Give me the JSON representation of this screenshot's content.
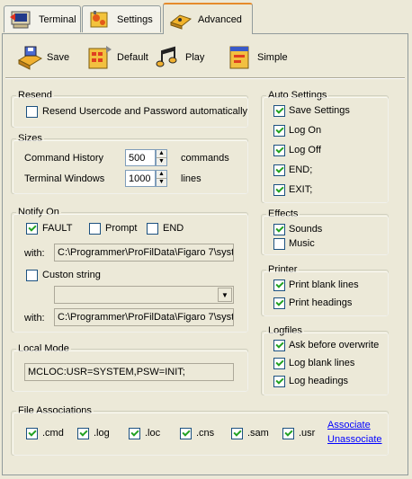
{
  "tabs": [
    {
      "label": "Terminal",
      "icon": "terminal-icon"
    },
    {
      "label": "Settings",
      "icon": "settings-icon"
    },
    {
      "label": "Advanced",
      "icon": "advanced-icon"
    }
  ],
  "toolbar": {
    "save_label": "Save",
    "default_label": "Default",
    "play_label": "Play",
    "simple_label": "Simple"
  },
  "resend": {
    "title": "Resend",
    "option": {
      "label": "Resend Usercode and Password automatically",
      "checked": false
    }
  },
  "sizes": {
    "title": "Sizes",
    "history_label": "Command History",
    "history_value": "500",
    "history_unit": "commands",
    "windows_label": "Terminal Windows",
    "windows_value": "1000",
    "windows_unit": "lines"
  },
  "notify": {
    "title": "Notify On",
    "fault": {
      "label": "FAULT",
      "checked": true
    },
    "prompt": {
      "label": "Prompt",
      "checked": false
    },
    "end": {
      "label": "END",
      "checked": false
    },
    "with_label": "with:",
    "with_path_1": "C:\\Programmer\\ProFilData\\Figaro 7\\syste",
    "custom": {
      "label": "Custon string",
      "checked": false
    },
    "custom_value": "",
    "with_path_2": "C:\\Programmer\\ProFilData\\Figaro 7\\syste"
  },
  "local_mode": {
    "title": "Local Mode",
    "value": "MCLOC:USR=SYSTEM,PSW=INIT;"
  },
  "file_assoc": {
    "title": "File Associations",
    "exts": [
      {
        "label": ".cmd",
        "checked": true
      },
      {
        "label": ".log",
        "checked": true
      },
      {
        "label": ".loc",
        "checked": true
      },
      {
        "label": ".cns",
        "checked": true
      },
      {
        "label": ".sam",
        "checked": true
      },
      {
        "label": ".usr",
        "checked": true
      }
    ],
    "associate_label": "Associate",
    "unassociate_label": "Unassociate"
  },
  "auto_settings": {
    "title": "Auto Settings",
    "items": [
      {
        "label": "Save Settings",
        "checked": true
      },
      {
        "label": "Log On",
        "checked": true
      },
      {
        "label": "Log Off",
        "checked": true
      },
      {
        "label": "END;",
        "checked": true
      },
      {
        "label": "EXIT;",
        "checked": true
      }
    ]
  },
  "effects": {
    "title": "Effects",
    "items": [
      {
        "label": "Sounds",
        "checked": true
      },
      {
        "label": "Music",
        "checked": false
      }
    ]
  },
  "printer": {
    "title": "Printer",
    "items": [
      {
        "label": "Print blank lines",
        "checked": true
      },
      {
        "label": "Print headings",
        "checked": true
      }
    ]
  },
  "logfiles": {
    "title": "Logfiles",
    "items": [
      {
        "label": "Ask before overwrite",
        "checked": true
      },
      {
        "label": "Log blank lines",
        "checked": true
      },
      {
        "label": "Log headings",
        "checked": true
      }
    ]
  },
  "colors": {
    "panel": "#ece9d8",
    "tab_accent": "#e68b2c",
    "check": "#21a121",
    "link": "#0000ff"
  }
}
